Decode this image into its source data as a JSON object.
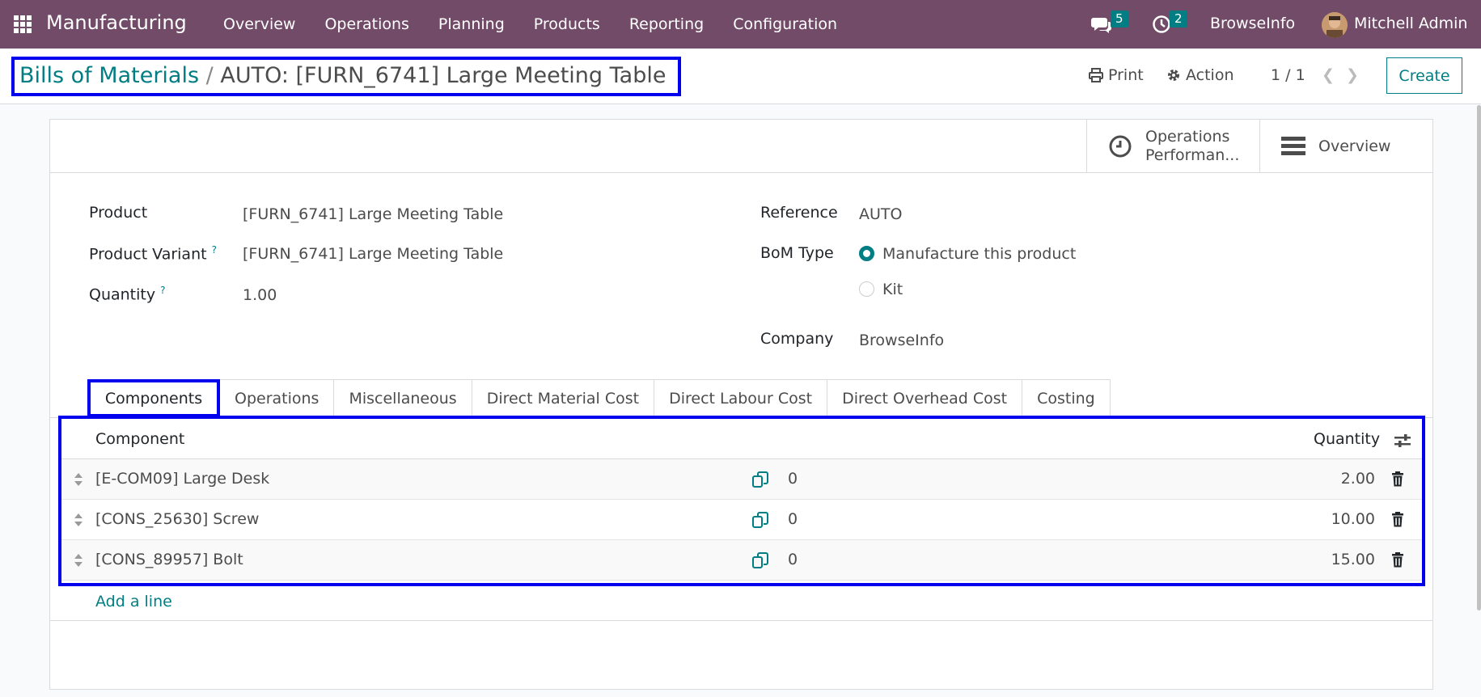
{
  "navbar": {
    "app_title": "Manufacturing",
    "menu": [
      "Overview",
      "Operations",
      "Planning",
      "Products",
      "Reporting",
      "Configuration"
    ],
    "messages_count": "5",
    "activities_count": "2",
    "company": "BrowseInfo",
    "user": "Mitchell Admin"
  },
  "control": {
    "breadcrumb_parent": "Bills of Materials",
    "breadcrumb_sep": "/",
    "breadcrumb_current": "AUTO: [FURN_6741] Large Meeting Table",
    "print": "Print",
    "action": "Action",
    "pager": "1 / 1",
    "create": "Create"
  },
  "button_box": {
    "operations_perf_line1": "Operations",
    "operations_perf_line2": "Performan...",
    "overview": "Overview"
  },
  "form": {
    "product_label": "Product",
    "product_value": "[FURN_6741] Large Meeting Table",
    "variant_label": "Product Variant",
    "variant_value": "[FURN_6741] Large Meeting Table",
    "quantity_label": "Quantity",
    "quantity_value": "1.00",
    "help_mark": "?",
    "reference_label": "Reference",
    "reference_value": "AUTO",
    "bom_type_label": "BoM Type",
    "bom_type_options": [
      "Manufacture this product",
      "Kit"
    ],
    "bom_type_selected": "Manufacture this product",
    "company_label": "Company",
    "company_value": "BrowseInfo"
  },
  "tabs": [
    "Components",
    "Operations",
    "Miscellaneous",
    "Direct Material Cost",
    "Direct Labour Cost",
    "Direct Overhead Cost",
    "Costing"
  ],
  "active_tab": "Components",
  "table": {
    "col_component": "Component",
    "col_quantity": "Quantity",
    "rows": [
      {
        "component": "[E-COM09] Large Desk",
        "count": "0",
        "quantity": "2.00"
      },
      {
        "component": "[CONS_25630] Screw",
        "count": "0",
        "quantity": "10.00"
      },
      {
        "component": "[CONS_89957] Bolt",
        "count": "0",
        "quantity": "15.00"
      }
    ],
    "add_line": "Add a line"
  },
  "colors": {
    "navbar": "#714b67",
    "accent": "#017e84",
    "highlight_border": "#0000ee"
  }
}
